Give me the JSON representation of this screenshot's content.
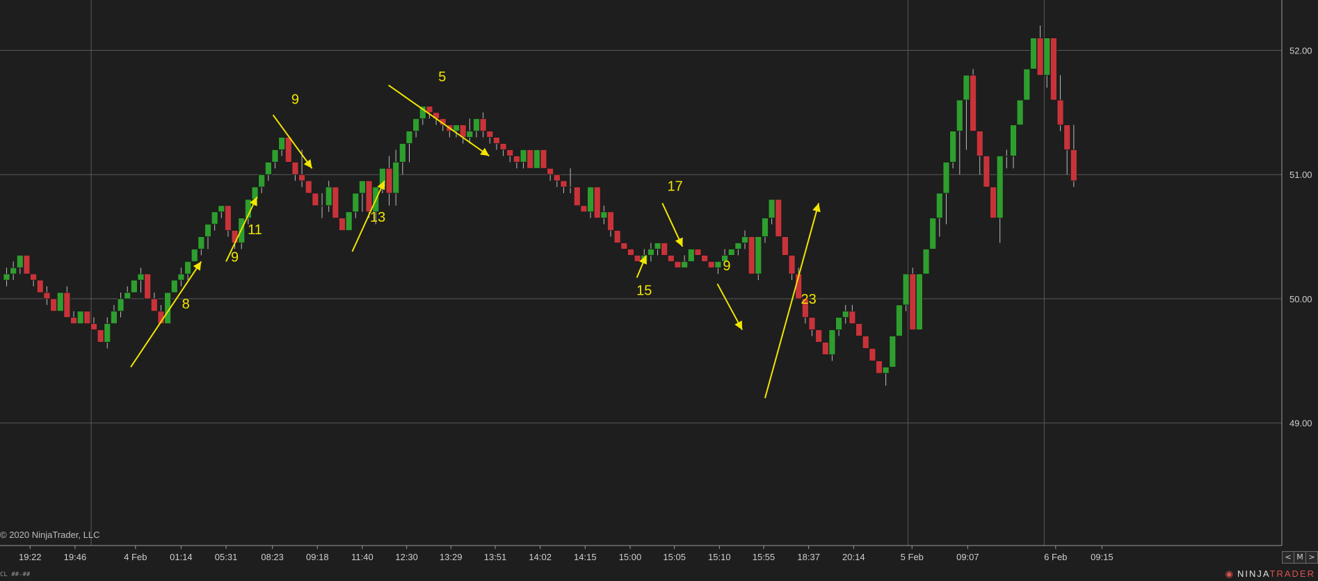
{
  "chart_data": {
    "type": "candlestick",
    "ylim": [
      48.0,
      52.4
    ],
    "y_ticks": [
      "52.00",
      "51.00",
      "50.00",
      "49.00"
    ],
    "y_tick_values": [
      52,
      51,
      50,
      49
    ],
    "x_ticks": [
      {
        "label": "19:22",
        "bar": 3.5
      },
      {
        "label": "19:46",
        "bar": 10.2
      },
      {
        "label": "4 Feb",
        "bar": 19.2
      },
      {
        "label": "01:14",
        "bar": 26.0
      },
      {
        "label": "05:31",
        "bar": 32.7
      },
      {
        "label": "08:23",
        "bar": 39.6
      },
      {
        "label": "09:18",
        "bar": 46.3
      },
      {
        "label": "11:40",
        "bar": 53.0
      },
      {
        "label": "12:30",
        "bar": 59.6
      },
      {
        "label": "13:29",
        "bar": 66.2
      },
      {
        "label": "13:51",
        "bar": 72.8
      },
      {
        "label": "14:02",
        "bar": 79.5
      },
      {
        "label": "14:15",
        "bar": 86.2
      },
      {
        "label": "15:00",
        "bar": 92.9
      },
      {
        "label": "15:05",
        "bar": 99.5
      },
      {
        "label": "15:10",
        "bar": 106.2
      },
      {
        "label": "15:55",
        "bar": 112.8
      },
      {
        "label": "18:37",
        "bar": 119.5
      },
      {
        "label": "20:14",
        "bar": 126.2
      },
      {
        "label": "5 Feb",
        "bar": 134.9
      },
      {
        "label": "09:07",
        "bar": 143.2
      },
      {
        "label": "6 Feb",
        "bar": 156.3
      },
      {
        "label": "09:15",
        "bar": 163.2
      }
    ],
    "day_separators": [
      12.6,
      134.3,
      154.6
    ],
    "bars_ohlc": [
      [
        50.15,
        50.25,
        50.1,
        50.2
      ],
      [
        50.2,
        50.3,
        50.15,
        50.25
      ],
      [
        50.25,
        50.35,
        50.2,
        50.35
      ],
      [
        50.35,
        50.35,
        50.2,
        50.2
      ],
      [
        50.2,
        50.2,
        50.1,
        50.15
      ],
      [
        50.15,
        50.15,
        50.05,
        50.05
      ],
      [
        50.05,
        50.1,
        49.95,
        50.0
      ],
      [
        50.0,
        50.0,
        49.9,
        49.9
      ],
      [
        49.9,
        50.05,
        49.9,
        50.05
      ],
      [
        50.05,
        50.1,
        49.85,
        49.85
      ],
      [
        49.85,
        49.9,
        49.8,
        49.8
      ],
      [
        49.8,
        49.9,
        49.8,
        49.9
      ],
      [
        49.9,
        49.9,
        49.8,
        49.8
      ],
      [
        49.8,
        49.85,
        49.75,
        49.75
      ],
      [
        49.75,
        49.75,
        49.65,
        49.65
      ],
      [
        49.65,
        49.85,
        49.6,
        49.8
      ],
      [
        49.8,
        49.95,
        49.8,
        49.9
      ],
      [
        49.9,
        50.05,
        49.85,
        50.0
      ],
      [
        50.0,
        50.1,
        50.0,
        50.05
      ],
      [
        50.05,
        50.15,
        50.05,
        50.15
      ],
      [
        50.15,
        50.25,
        50.05,
        50.2
      ],
      [
        50.2,
        50.2,
        50.0,
        50.0
      ],
      [
        50.0,
        50.05,
        49.9,
        49.9
      ],
      [
        49.9,
        49.95,
        49.8,
        49.8
      ],
      [
        49.8,
        50.05,
        49.8,
        50.05
      ],
      [
        50.05,
        50.15,
        50.05,
        50.15
      ],
      [
        50.15,
        50.25,
        50.1,
        50.2
      ],
      [
        50.2,
        50.3,
        50.15,
        50.3
      ],
      [
        50.3,
        50.4,
        50.3,
        50.4
      ],
      [
        50.4,
        50.5,
        50.35,
        50.5
      ],
      [
        50.5,
        50.6,
        50.4,
        50.6
      ],
      [
        50.6,
        50.7,
        50.55,
        50.7
      ],
      [
        50.7,
        50.75,
        50.65,
        50.75
      ],
      [
        50.75,
        50.75,
        50.5,
        50.55
      ],
      [
        50.55,
        50.55,
        50.4,
        50.45
      ],
      [
        50.45,
        50.65,
        50.4,
        50.65
      ],
      [
        50.65,
        50.8,
        50.6,
        50.8
      ],
      [
        50.8,
        50.9,
        50.75,
        50.9
      ],
      [
        50.9,
        51.0,
        50.85,
        51.0
      ],
      [
        51.0,
        51.1,
        50.95,
        51.1
      ],
      [
        51.1,
        51.2,
        51.05,
        51.2
      ],
      [
        51.2,
        51.3,
        51.15,
        51.3
      ],
      [
        51.3,
        51.3,
        51.1,
        51.1
      ],
      [
        51.1,
        51.1,
        50.95,
        51.0
      ],
      [
        51.0,
        51.2,
        50.9,
        50.95
      ],
      [
        50.95,
        50.95,
        50.85,
        50.85
      ],
      [
        50.85,
        50.85,
        50.75,
        50.75
      ],
      [
        50.75,
        50.85,
        50.65,
        50.75
      ],
      [
        50.75,
        50.95,
        50.7,
        50.9
      ],
      [
        50.9,
        50.9,
        50.65,
        50.65
      ],
      [
        50.65,
        50.65,
        50.55,
        50.55
      ],
      [
        50.55,
        50.7,
        50.55,
        50.7
      ],
      [
        50.7,
        50.85,
        50.65,
        50.85
      ],
      [
        50.85,
        50.95,
        50.7,
        50.95
      ],
      [
        50.95,
        50.95,
        50.65,
        50.7
      ],
      [
        50.7,
        50.9,
        50.6,
        50.9
      ],
      [
        50.9,
        51.05,
        50.85,
        51.05
      ],
      [
        51.05,
        51.15,
        50.75,
        50.85
      ],
      [
        50.85,
        51.2,
        50.75,
        51.1
      ],
      [
        51.1,
        51.25,
        51.0,
        51.25
      ],
      [
        51.25,
        51.35,
        51.1,
        51.35
      ],
      [
        51.35,
        51.45,
        51.3,
        51.45
      ],
      [
        51.45,
        51.55,
        51.4,
        51.55
      ],
      [
        51.55,
        51.55,
        51.45,
        51.5
      ],
      [
        51.5,
        51.5,
        51.4,
        51.45
      ],
      [
        51.45,
        51.45,
        51.35,
        51.4
      ],
      [
        51.4,
        51.4,
        51.3,
        51.35
      ],
      [
        51.35,
        51.4,
        51.3,
        51.4
      ],
      [
        51.4,
        51.4,
        51.25,
        51.3
      ],
      [
        51.3,
        51.45,
        51.25,
        51.35
      ],
      [
        51.35,
        51.45,
        51.3,
        51.45
      ],
      [
        51.45,
        51.5,
        51.3,
        51.35
      ],
      [
        51.35,
        51.35,
        51.25,
        51.3
      ],
      [
        51.3,
        51.3,
        51.2,
        51.25
      ],
      [
        51.25,
        51.25,
        51.15,
        51.2
      ],
      [
        51.2,
        51.2,
        51.1,
        51.15
      ],
      [
        51.15,
        51.15,
        51.05,
        51.1
      ],
      [
        51.1,
        51.2,
        51.05,
        51.2
      ],
      [
        51.2,
        51.2,
        51.05,
        51.05
      ],
      [
        51.05,
        51.2,
        51.05,
        51.2
      ],
      [
        51.2,
        51.2,
        51.05,
        51.05
      ],
      [
        51.05,
        51.05,
        50.95,
        51.0
      ],
      [
        51.0,
        51.0,
        50.9,
        50.95
      ],
      [
        50.95,
        50.95,
        50.85,
        50.9
      ],
      [
        50.9,
        51.05,
        50.85,
        50.9
      ],
      [
        50.9,
        50.9,
        50.75,
        50.75
      ],
      [
        50.75,
        50.75,
        50.7,
        50.7
      ],
      [
        50.7,
        50.9,
        50.65,
        50.9
      ],
      [
        50.9,
        50.9,
        50.65,
        50.65
      ],
      [
        50.65,
        50.75,
        50.6,
        50.7
      ],
      [
        50.7,
        50.7,
        50.5,
        50.55
      ],
      [
        50.55,
        50.55,
        50.45,
        50.45
      ],
      [
        50.45,
        50.45,
        50.4,
        50.4
      ],
      [
        50.4,
        50.4,
        50.35,
        50.35
      ],
      [
        50.35,
        50.35,
        50.3,
        50.3
      ],
      [
        50.3,
        50.4,
        50.3,
        50.35
      ],
      [
        50.35,
        50.45,
        50.3,
        50.4
      ],
      [
        50.4,
        50.45,
        50.35,
        50.45
      ],
      [
        50.45,
        50.45,
        50.35,
        50.35
      ],
      [
        50.35,
        50.35,
        50.3,
        50.3
      ],
      [
        50.3,
        50.3,
        50.25,
        50.25
      ],
      [
        50.25,
        50.35,
        50.25,
        50.3
      ],
      [
        50.3,
        50.4,
        50.3,
        50.4
      ],
      [
        50.4,
        50.4,
        50.35,
        50.35
      ],
      [
        50.35,
        50.35,
        50.3,
        50.3
      ],
      [
        50.3,
        50.3,
        50.25,
        50.25
      ],
      [
        50.25,
        50.3,
        50.2,
        50.3
      ],
      [
        50.3,
        50.4,
        50.3,
        50.35
      ],
      [
        50.35,
        50.4,
        50.35,
        50.4
      ],
      [
        50.4,
        50.45,
        50.35,
        50.45
      ],
      [
        50.45,
        50.55,
        50.4,
        50.5
      ],
      [
        50.5,
        50.5,
        50.2,
        50.2
      ],
      [
        50.2,
        50.5,
        50.15,
        50.5
      ],
      [
        50.5,
        50.65,
        50.45,
        50.65
      ],
      [
        50.65,
        50.8,
        50.6,
        50.8
      ],
      [
        50.8,
        50.8,
        50.5,
        50.5
      ],
      [
        50.5,
        50.5,
        50.35,
        50.35
      ],
      [
        50.35,
        50.35,
        50.15,
        50.2
      ],
      [
        50.2,
        50.25,
        50.0,
        50.0
      ],
      [
        50.0,
        50.0,
        49.8,
        49.85
      ],
      [
        49.85,
        49.85,
        49.7,
        49.75
      ],
      [
        49.75,
        49.75,
        49.65,
        49.65
      ],
      [
        49.65,
        49.65,
        49.55,
        49.55
      ],
      [
        49.55,
        49.75,
        49.5,
        49.75
      ],
      [
        49.75,
        49.85,
        49.7,
        49.85
      ],
      [
        49.85,
        49.95,
        49.8,
        49.9
      ],
      [
        49.9,
        49.95,
        49.8,
        49.8
      ],
      [
        49.8,
        49.8,
        49.7,
        49.7
      ],
      [
        49.7,
        49.7,
        49.6,
        49.6
      ],
      [
        49.6,
        49.6,
        49.5,
        49.5
      ],
      [
        49.5,
        49.5,
        49.4,
        49.4
      ],
      [
        49.4,
        49.45,
        49.3,
        49.45
      ],
      [
        49.45,
        49.7,
        49.45,
        49.7
      ],
      [
        49.7,
        49.95,
        49.7,
        49.95
      ],
      [
        49.95,
        50.2,
        49.9,
        50.2
      ],
      [
        50.2,
        50.25,
        49.75,
        49.75
      ],
      [
        49.75,
        50.2,
        49.75,
        50.2
      ],
      [
        50.2,
        50.4,
        50.2,
        50.4
      ],
      [
        50.4,
        50.65,
        50.4,
        50.65
      ],
      [
        50.65,
        50.85,
        50.5,
        50.85
      ],
      [
        50.85,
        51.1,
        50.6,
        51.1
      ],
      [
        51.1,
        51.35,
        51.05,
        51.35
      ],
      [
        51.35,
        51.6,
        51.0,
        51.6
      ],
      [
        51.6,
        51.8,
        51.2,
        51.8
      ],
      [
        51.8,
        51.85,
        51.35,
        51.35
      ],
      [
        51.35,
        51.35,
        51.0,
        51.15
      ],
      [
        51.15,
        51.15,
        50.9,
        50.9
      ],
      [
        50.9,
        50.9,
        50.65,
        50.65
      ],
      [
        50.65,
        51.15,
        50.45,
        51.15
      ],
      [
        51.15,
        51.2,
        51.05,
        51.15
      ],
      [
        51.15,
        51.4,
        51.05,
        51.4
      ],
      [
        51.4,
        51.6,
        51.4,
        51.6
      ],
      [
        51.6,
        51.85,
        51.6,
        51.85
      ],
      [
        51.85,
        52.1,
        51.85,
        52.1
      ],
      [
        52.1,
        52.2,
        51.8,
        51.8
      ],
      [
        51.8,
        52.1,
        51.7,
        52.1
      ],
      [
        52.1,
        52.1,
        51.6,
        51.6
      ],
      [
        51.6,
        51.8,
        51.35,
        51.4
      ],
      [
        51.4,
        51.4,
        51.0,
        51.2
      ],
      [
        51.2,
        51.4,
        50.9,
        50.95
      ]
    ],
    "annotations": [
      {
        "label": "8",
        "from": [
          18.5,
          49.45
        ],
        "to": [
          29.0,
          50.3
        ],
        "label_at": [
          26.7,
          49.92
        ]
      },
      {
        "label": "9",
        "from": [
          32.7,
          50.3
        ],
        "to": [
          37.3,
          50.82
        ],
        "label_at": [
          34.0,
          50.3
        ]
      },
      {
        "label": "11",
        "label_at": [
          37.0,
          50.52
        ]
      },
      {
        "label": "9",
        "from": [
          39.7,
          51.48
        ],
        "to": [
          45.5,
          51.05
        ],
        "label_at": [
          43.0,
          51.57
        ]
      },
      {
        "label": "13",
        "from": [
          51.5,
          50.38
        ],
        "to": [
          56.3,
          50.95
        ],
        "label_at": [
          55.3,
          50.62
        ]
      },
      {
        "label": "5",
        "from": [
          56.9,
          51.72
        ],
        "to": [
          71.9,
          51.15
        ],
        "label_at": [
          64.9,
          51.75
        ]
      },
      {
        "label": "17",
        "from": [
          97.7,
          50.77
        ],
        "to": [
          100.7,
          50.42
        ],
        "label_at": [
          99.6,
          50.87
        ]
      },
      {
        "label": "15",
        "from": [
          93.9,
          50.17
        ],
        "to": [
          95.3,
          50.35
        ],
        "label_at": [
          95.0,
          50.03
        ]
      },
      {
        "label": "9",
        "from": [
          105.9,
          50.12
        ],
        "to": [
          109.6,
          49.75
        ],
        "label_at": [
          107.3,
          50.23
        ]
      },
      {
        "label": "23",
        "from": [
          113.0,
          49.2
        ],
        "to": [
          121.0,
          50.77
        ],
        "label_at": [
          119.5,
          49.96
        ]
      }
    ],
    "copyright": "© 2020 NinjaTrader, LLC",
    "brand": "NINJATRADER",
    "corner_text": "CL ##-##",
    "nav_buttons": [
      "<",
      "M",
      ">"
    ]
  }
}
